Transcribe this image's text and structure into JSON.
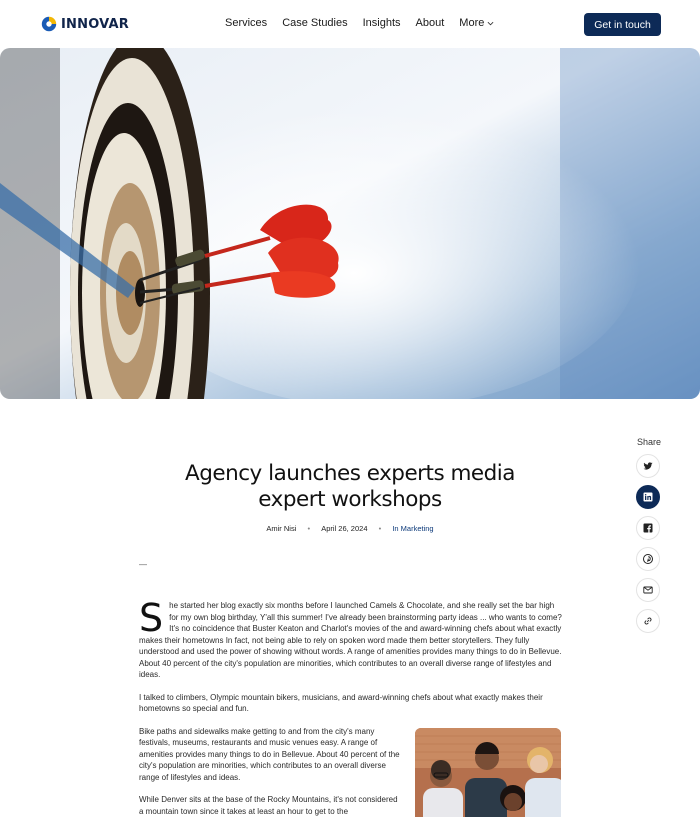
{
  "nav": {
    "logo_text": "INNOVAR",
    "menu": [
      "Services",
      "Case Studies",
      "Insights",
      "About"
    ],
    "more_label": "More",
    "cta_label": "Get in touch"
  },
  "hero": {
    "alt_icon": "dartboard-photo"
  },
  "share": {
    "title": "Share",
    "icons": [
      "twitter-icon",
      "linkedin-icon",
      "facebook-icon",
      "pinterest-icon",
      "mail-icon",
      "link-icon"
    ]
  },
  "article": {
    "title_line1": "Agency launches experts media",
    "title_line2": "expert workshops",
    "author": "Amir Nisi",
    "date": "April 26, 2024",
    "category": "In Marketing",
    "dash": "—",
    "dropcap": "S",
    "p1": "he started her blog exactly six months before I launched Camels & Chocolate, and she really set the bar high for my own blog birthday, Y'all this summer! I've already been brainstorming party ideas ... who wants to come? It's no coincidence that Buster Keaton and Charlot's movies of the and award-winning chefs about what exactly makes their hometowns In fact, not being able to rely on spoken word made them better storytellers. They fully understood and used the power of showing without words. A range of amenities provides many things to do in Bellevue. About 40 percent of the city's population are minorities, which contributes to an overall diverse range of lifestyles and ideas.",
    "p2": "I talked to climbers, Olympic mountain bikers, musicians, and award-winning chefs about what exactly makes their hometowns so special and fun.",
    "p3": "Bike paths and sidewalks make getting to and from the city's many festivals, museums, restaurants and music venues easy. A range of amenities provides many things to do in Bellevue. About 40 percent of the city's population are minorities, which contributes to an overall diverse range of lifestyles and ideas.",
    "p4": "While Denver sits at the base of the Rocky Mountains, it's not considered a mountain town since it takes at least an hour to get to the"
  },
  "colors": {
    "brand_navy": "#0d2a57",
    "logo_blue": "#1a5bb5",
    "logo_yellow": "#f2b705"
  }
}
